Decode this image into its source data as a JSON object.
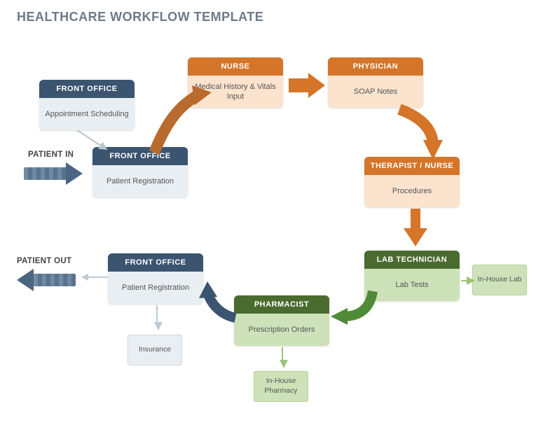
{
  "title": "HEALTHCARE WORKFLOW TEMPLATE",
  "labels": {
    "in": "PATIENT IN",
    "out": "PATIENT OUT"
  },
  "nodes": {
    "fo_sched": {
      "header": "FRONT OFFICE",
      "body": "Appointment Scheduling"
    },
    "fo_reg": {
      "header": "FRONT OFFICE",
      "body": "Patient Registration"
    },
    "nurse": {
      "header": "NURSE",
      "body": "Medical History & Vitals Input"
    },
    "physician": {
      "header": "PHYSICIAN",
      "body": "SOAP Notes"
    },
    "therapist": {
      "header": "THERAPIST / NURSE",
      "body": "Procedures"
    },
    "labtech": {
      "header": "LAB TECHNICIAN",
      "body": "Lab Tests"
    },
    "pharmacist": {
      "header": "PHARMACIST",
      "body": "Prescription Orders"
    },
    "fo_reg2": {
      "header": "FRONT OFFICE",
      "body": "Patient Registration"
    }
  },
  "tags": {
    "inhouse_lab": "In-House Lab",
    "inhouse_pharm": "In-House Pharmacy",
    "insurance": "Insurance"
  }
}
